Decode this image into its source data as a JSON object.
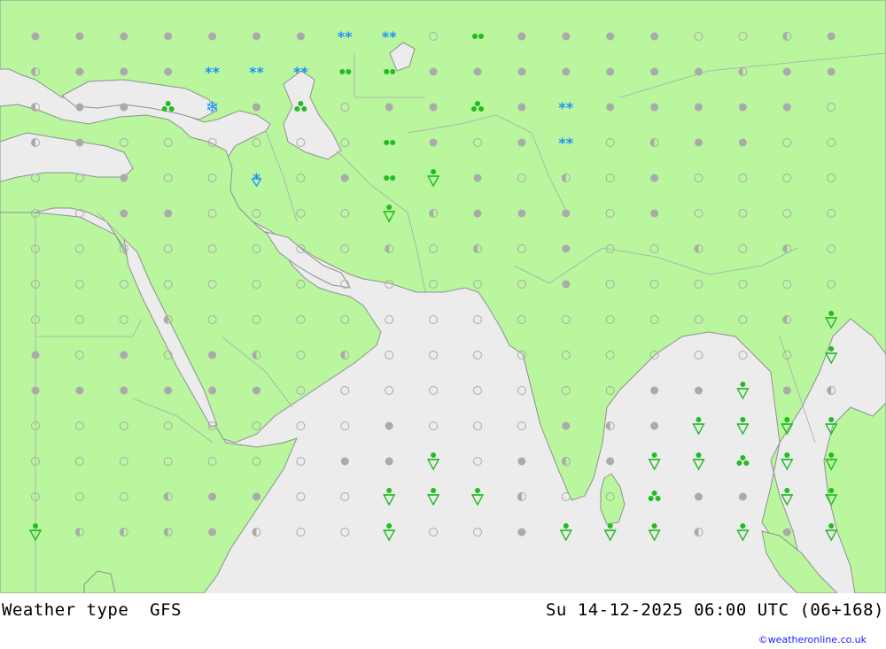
{
  "map": {
    "colors": {
      "land": "#b9f69e",
      "sea": "#ececec",
      "border": "#aaaaaa",
      "coast": "#909090",
      "dot": "#aaaaaa",
      "rain": "#22bb22",
      "snow": "#1e90ff"
    },
    "legend_symbols": [
      "dot-full",
      "dot-half",
      "dot-empty",
      "rain-light",
      "drizzle",
      "rain-showers",
      "heavy-rain",
      "snow",
      "snow-showers"
    ]
  },
  "footer": {
    "title": "Weather type  GFS",
    "time": "Su 14-12-2025 06:00 UTC (06+168)",
    "credit": "©weatheronline.co.uk"
  }
}
